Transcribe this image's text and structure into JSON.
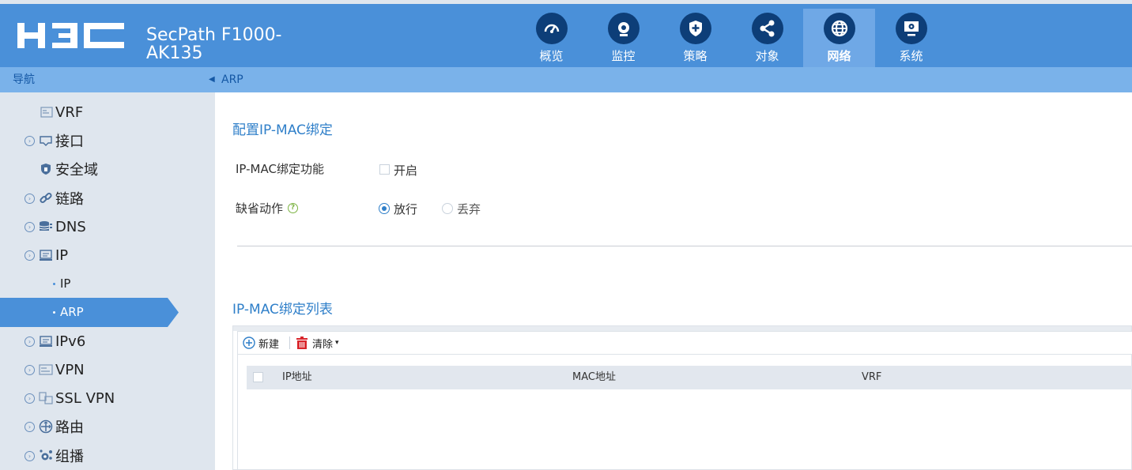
{
  "header": {
    "logo_text": "H3C",
    "product_line1": "SecPath F1000-",
    "product_line2": "AK135",
    "nav": [
      {
        "label": "概览",
        "icon": "gauge-icon"
      },
      {
        "label": "监控",
        "icon": "webcam-icon"
      },
      {
        "label": "策略",
        "icon": "shield-plus-icon"
      },
      {
        "label": "对象",
        "icon": "share-icon"
      },
      {
        "label": "网络",
        "icon": "globe-icon",
        "active": true
      },
      {
        "label": "系统",
        "icon": "monitor-settings-icon"
      }
    ]
  },
  "sidebar": {
    "title": "导航",
    "items": [
      {
        "label": "VRF",
        "icon": "vrf-icon"
      },
      {
        "label": "接口",
        "icon": "interface-icon"
      },
      {
        "label": "安全域",
        "icon": "security-zone-icon"
      },
      {
        "label": "链路",
        "icon": "link-icon"
      },
      {
        "label": "DNS",
        "icon": "dns-icon"
      },
      {
        "label": "IP",
        "icon": "ip-icon"
      },
      {
        "label": "IP",
        "sub": true
      },
      {
        "label": "ARP",
        "sub": true,
        "active": true
      },
      {
        "label": "IPv6",
        "icon": "ipv6-icon"
      },
      {
        "label": "VPN",
        "icon": "vpn-icon"
      },
      {
        "label": "SSL VPN",
        "icon": "ssl-vpn-icon"
      },
      {
        "label": "路由",
        "icon": "routing-icon"
      },
      {
        "label": "组播",
        "icon": "multicast-icon"
      }
    ]
  },
  "breadcrumb": "ARP",
  "config": {
    "title": "配置IP-MAC绑定",
    "binding_label": "IP-MAC绑定功能",
    "binding_option": "开启",
    "binding_enabled": false,
    "default_action_label": "缺省动作",
    "action_allow": "放行",
    "action_drop": "丢弃",
    "selected_action": "放行"
  },
  "list": {
    "title": "IP-MAC绑定列表",
    "toolbar": {
      "new_label": "新建",
      "clear_label": "清除"
    },
    "columns": [
      "IP地址",
      "MAC地址",
      "VRF"
    ],
    "rows": []
  },
  "colors": {
    "header_bg": "#4a90d9",
    "nav_active_bg": "#6fa8e6",
    "sidebar_bg": "#dfe6ee",
    "accent": "#2f7fc9",
    "sidebar_active": "#4a90d9"
  }
}
